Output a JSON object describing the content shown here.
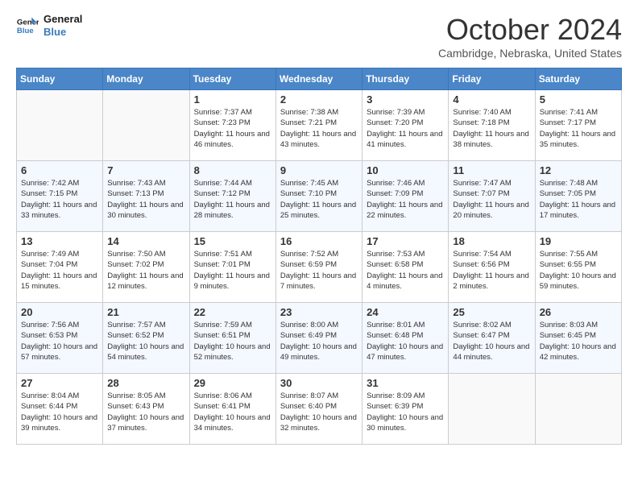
{
  "header": {
    "logo_line1": "General",
    "logo_line2": "Blue",
    "month": "October 2024",
    "location": "Cambridge, Nebraska, United States"
  },
  "days_of_week": [
    "Sunday",
    "Monday",
    "Tuesday",
    "Wednesday",
    "Thursday",
    "Friday",
    "Saturday"
  ],
  "weeks": [
    [
      {
        "day": "",
        "info": ""
      },
      {
        "day": "",
        "info": ""
      },
      {
        "day": "1",
        "info": "Sunrise: 7:37 AM\nSunset: 7:23 PM\nDaylight: 11 hours and 46 minutes."
      },
      {
        "day": "2",
        "info": "Sunrise: 7:38 AM\nSunset: 7:21 PM\nDaylight: 11 hours and 43 minutes."
      },
      {
        "day": "3",
        "info": "Sunrise: 7:39 AM\nSunset: 7:20 PM\nDaylight: 11 hours and 41 minutes."
      },
      {
        "day": "4",
        "info": "Sunrise: 7:40 AM\nSunset: 7:18 PM\nDaylight: 11 hours and 38 minutes."
      },
      {
        "day": "5",
        "info": "Sunrise: 7:41 AM\nSunset: 7:17 PM\nDaylight: 11 hours and 35 minutes."
      }
    ],
    [
      {
        "day": "6",
        "info": "Sunrise: 7:42 AM\nSunset: 7:15 PM\nDaylight: 11 hours and 33 minutes."
      },
      {
        "day": "7",
        "info": "Sunrise: 7:43 AM\nSunset: 7:13 PM\nDaylight: 11 hours and 30 minutes."
      },
      {
        "day": "8",
        "info": "Sunrise: 7:44 AM\nSunset: 7:12 PM\nDaylight: 11 hours and 28 minutes."
      },
      {
        "day": "9",
        "info": "Sunrise: 7:45 AM\nSunset: 7:10 PM\nDaylight: 11 hours and 25 minutes."
      },
      {
        "day": "10",
        "info": "Sunrise: 7:46 AM\nSunset: 7:09 PM\nDaylight: 11 hours and 22 minutes."
      },
      {
        "day": "11",
        "info": "Sunrise: 7:47 AM\nSunset: 7:07 PM\nDaylight: 11 hours and 20 minutes."
      },
      {
        "day": "12",
        "info": "Sunrise: 7:48 AM\nSunset: 7:05 PM\nDaylight: 11 hours and 17 minutes."
      }
    ],
    [
      {
        "day": "13",
        "info": "Sunrise: 7:49 AM\nSunset: 7:04 PM\nDaylight: 11 hours and 15 minutes."
      },
      {
        "day": "14",
        "info": "Sunrise: 7:50 AM\nSunset: 7:02 PM\nDaylight: 11 hours and 12 minutes."
      },
      {
        "day": "15",
        "info": "Sunrise: 7:51 AM\nSunset: 7:01 PM\nDaylight: 11 hours and 9 minutes."
      },
      {
        "day": "16",
        "info": "Sunrise: 7:52 AM\nSunset: 6:59 PM\nDaylight: 11 hours and 7 minutes."
      },
      {
        "day": "17",
        "info": "Sunrise: 7:53 AM\nSunset: 6:58 PM\nDaylight: 11 hours and 4 minutes."
      },
      {
        "day": "18",
        "info": "Sunrise: 7:54 AM\nSunset: 6:56 PM\nDaylight: 11 hours and 2 minutes."
      },
      {
        "day": "19",
        "info": "Sunrise: 7:55 AM\nSunset: 6:55 PM\nDaylight: 10 hours and 59 minutes."
      }
    ],
    [
      {
        "day": "20",
        "info": "Sunrise: 7:56 AM\nSunset: 6:53 PM\nDaylight: 10 hours and 57 minutes."
      },
      {
        "day": "21",
        "info": "Sunrise: 7:57 AM\nSunset: 6:52 PM\nDaylight: 10 hours and 54 minutes."
      },
      {
        "day": "22",
        "info": "Sunrise: 7:59 AM\nSunset: 6:51 PM\nDaylight: 10 hours and 52 minutes."
      },
      {
        "day": "23",
        "info": "Sunrise: 8:00 AM\nSunset: 6:49 PM\nDaylight: 10 hours and 49 minutes."
      },
      {
        "day": "24",
        "info": "Sunrise: 8:01 AM\nSunset: 6:48 PM\nDaylight: 10 hours and 47 minutes."
      },
      {
        "day": "25",
        "info": "Sunrise: 8:02 AM\nSunset: 6:47 PM\nDaylight: 10 hours and 44 minutes."
      },
      {
        "day": "26",
        "info": "Sunrise: 8:03 AM\nSunset: 6:45 PM\nDaylight: 10 hours and 42 minutes."
      }
    ],
    [
      {
        "day": "27",
        "info": "Sunrise: 8:04 AM\nSunset: 6:44 PM\nDaylight: 10 hours and 39 minutes."
      },
      {
        "day": "28",
        "info": "Sunrise: 8:05 AM\nSunset: 6:43 PM\nDaylight: 10 hours and 37 minutes."
      },
      {
        "day": "29",
        "info": "Sunrise: 8:06 AM\nSunset: 6:41 PM\nDaylight: 10 hours and 34 minutes."
      },
      {
        "day": "30",
        "info": "Sunrise: 8:07 AM\nSunset: 6:40 PM\nDaylight: 10 hours and 32 minutes."
      },
      {
        "day": "31",
        "info": "Sunrise: 8:09 AM\nSunset: 6:39 PM\nDaylight: 10 hours and 30 minutes."
      },
      {
        "day": "",
        "info": ""
      },
      {
        "day": "",
        "info": ""
      }
    ]
  ]
}
